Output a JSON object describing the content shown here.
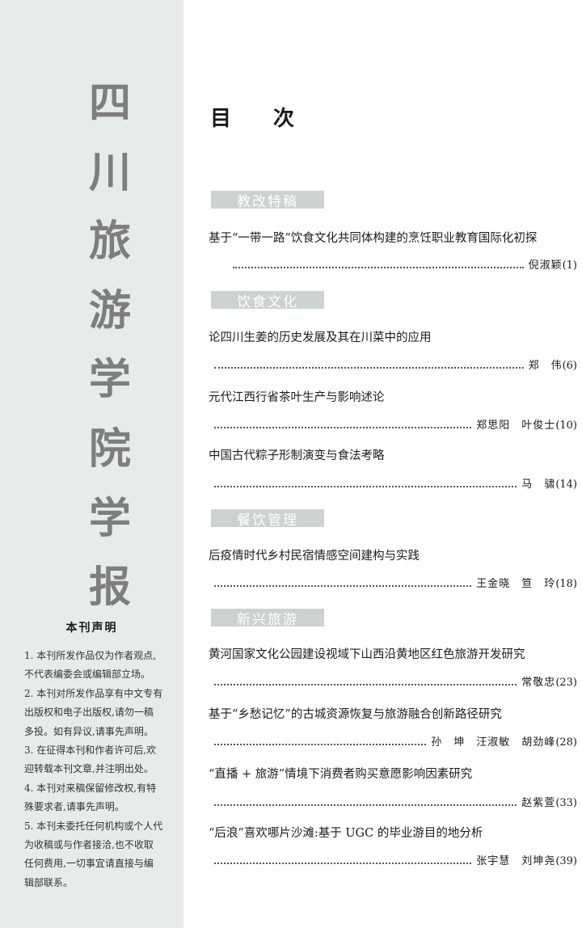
{
  "journal_title": [
    "四",
    "川",
    "旅",
    "游",
    "学",
    "院",
    "学",
    "报"
  ],
  "declaration": {
    "title": "本刊声明",
    "lines": [
      "1. 本刊所发作品仅为作者观点,",
      "不代表编委会或编辑部立场。",
      "2. 本刊对所发作品享有中文专有",
      "出版权和电子出版权,请勿一稿",
      "多投。如有异议,请事先声明。",
      "3. 在征得本刊和作者许可后,欢",
      "迎转载本刊文章,并注明出处。",
      "4. 本刊对来稿保留修改权,有特",
      "殊要求者,请事先声明。",
      "5. 本刊未委托任何机构或个人代",
      "为收稿或与作者接洽,也不收取",
      "任何费用,一切事宜请直接与编",
      "辑部联系。"
    ]
  },
  "toc": {
    "title_part1": "目",
    "title_part2": "次",
    "sections": [
      {
        "name": "教改特稿",
        "articles": [
          {
            "title": "基于“一带一路”饮食文化共同体构建的烹饪职业教育国际化初探",
            "authors": "倪淑颖",
            "page": "(1)"
          }
        ]
      },
      {
        "name": "饮食文化",
        "articles": [
          {
            "title": "论四川生姜的历史发展及其在川菜中的应用",
            "authors": "郑　伟",
            "page": "(6)"
          },
          {
            "title": "元代江西行省茶叶生产与影响述论",
            "authors": "郑思阳　叶俊士",
            "page": "(10)"
          },
          {
            "title": "中国古代粽子形制演变与食法考略",
            "authors": "马　骕",
            "page": "(14)"
          }
        ]
      },
      {
        "name": "餐饮管理",
        "articles": [
          {
            "title": "后疫情时代乡村民宿情感空间建构与实践",
            "authors": "王金晓　笪　玲",
            "page": "(18)"
          }
        ]
      },
      {
        "name": "新兴旅游",
        "articles": [
          {
            "title": "黄河国家文化公园建设视域下山西沿黄地区红色旅游开发研究",
            "authors": "常敬忠",
            "page": "(23)"
          },
          {
            "title": "基于“乡愁记忆”的古城资源恢复与旅游融合创新路径研究",
            "authors": "孙　坤　汪淑敏　胡劲峰",
            "page": "(28)"
          },
          {
            "title": "“直播 + 旅游”情境下消费者购买意愿影响因素研究",
            "authors": "赵紫萱",
            "page": "(33)"
          },
          {
            "title": "“后浪”喜欢哪片沙滩:基于 UGC 的毕业游目的地分析",
            "authors": "张宇慧　刘坤尧",
            "page": "(39)"
          }
        ]
      }
    ]
  }
}
